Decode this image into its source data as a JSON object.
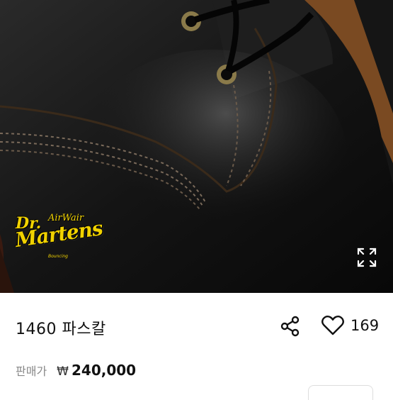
{
  "image": {
    "alt_icon": "product-photo",
    "logo": {
      "dr": "Dr.",
      "airwair": "AirWair",
      "martens": "Martens",
      "bouncing": "Bouncing"
    },
    "expand_icon": "expand-icon"
  },
  "product": {
    "title": "1460 파스칼",
    "price_label": "판매가",
    "currency": "₩",
    "price": "240,000"
  },
  "actions": {
    "share_icon": "share-icon",
    "like_icon": "heart-icon",
    "like_count": "169"
  },
  "colors": {
    "logo_yellow": "#f1d200",
    "text": "#111111",
    "muted": "#888888"
  }
}
